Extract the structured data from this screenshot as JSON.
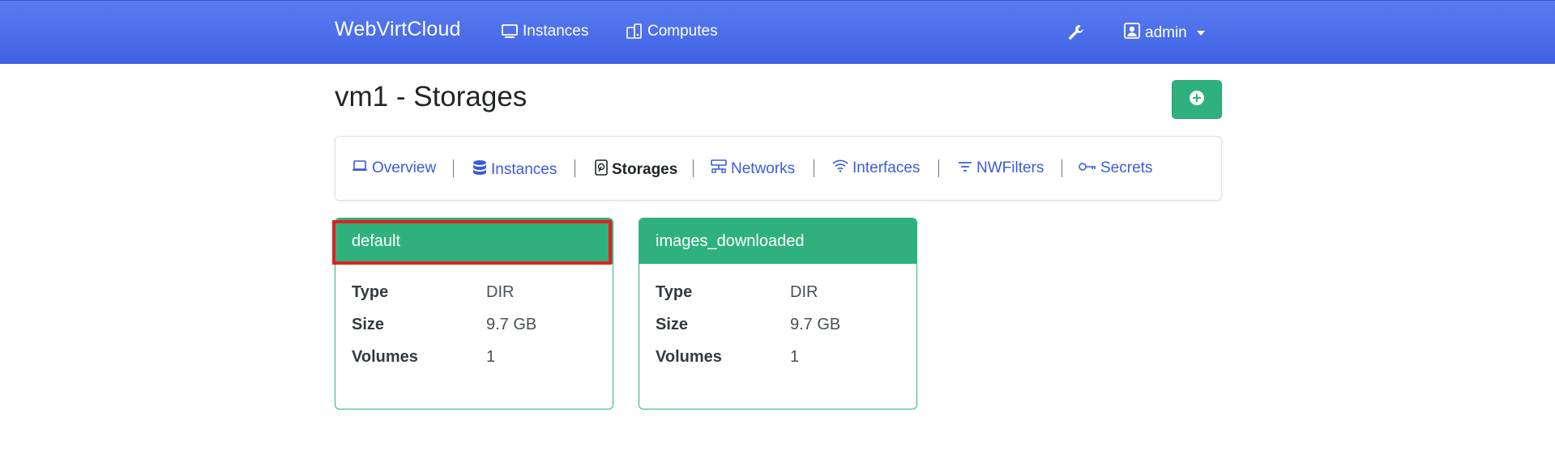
{
  "navbar": {
    "brand": "WebVirtCloud",
    "links": [
      {
        "label": "Instances",
        "icon": "desktop-icon"
      },
      {
        "label": "Computes",
        "icon": "server-icon"
      }
    ],
    "tools_icon": "wrench-icon",
    "user": {
      "label": "admin",
      "icon": "user-icon"
    }
  },
  "page": {
    "title": "vm1 - Storages",
    "add_button_icon": "plus-circle-icon"
  },
  "tabs": [
    {
      "label": "Overview",
      "icon": "laptop-icon",
      "active": false
    },
    {
      "label": "Instances",
      "icon": "database-icon",
      "active": false
    },
    {
      "label": "Storages",
      "icon": "hdd-icon",
      "active": true
    },
    {
      "label": "Networks",
      "icon": "network-icon",
      "active": false
    },
    {
      "label": "Interfaces",
      "icon": "wifi-icon",
      "active": false
    },
    {
      "label": "NWFilters",
      "icon": "filter-icon",
      "active": false
    },
    {
      "label": "Secrets",
      "icon": "key-icon",
      "active": false
    }
  ],
  "pools": [
    {
      "name": "default",
      "rows": [
        {
          "key": "Type",
          "value": "DIR"
        },
        {
          "key": "Size",
          "value": "9.7 GB"
        },
        {
          "key": "Volumes",
          "value": "1"
        }
      ]
    },
    {
      "name": "images_downloaded",
      "rows": [
        {
          "key": "Type",
          "value": "DIR"
        },
        {
          "key": "Size",
          "value": "9.7 GB"
        },
        {
          "key": "Volumes",
          "value": "1"
        }
      ]
    }
  ],
  "colors": {
    "navbar": "#4a6de8",
    "success": "#2fb17e",
    "link": "#3b5bdb",
    "highlight": "#e02020"
  }
}
